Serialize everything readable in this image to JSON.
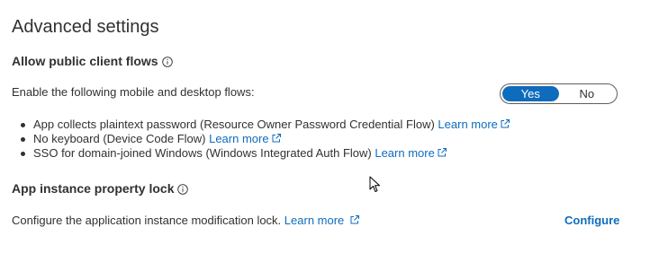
{
  "section": {
    "title": "Advanced settings"
  },
  "public_client_flows": {
    "heading": "Allow public client flows",
    "description": "Enable the following mobile and desktop flows:",
    "toggle": {
      "yes_label": "Yes",
      "no_label": "No",
      "selected": "Yes"
    },
    "items": [
      {
        "text": "App collects plaintext password (Resource Owner Password Credential Flow)",
        "link": "Learn more"
      },
      {
        "text": "No keyboard (Device Code Flow)",
        "link": "Learn more"
      },
      {
        "text": "SSO for domain-joined Windows (Windows Integrated Auth Flow)",
        "link": "Learn more"
      }
    ]
  },
  "instance_property_lock": {
    "heading": "App instance property lock",
    "description": "Configure the application instance modification lock.",
    "link": "Learn more",
    "action_label": "Configure"
  },
  "icons": {
    "info": "info-icon",
    "external_link": "external-link-icon",
    "cursor": "mouse-pointer-icon"
  },
  "colors": {
    "accent": "#0f6cbd",
    "text": "#323130",
    "toggle_border": "#605e5c"
  }
}
